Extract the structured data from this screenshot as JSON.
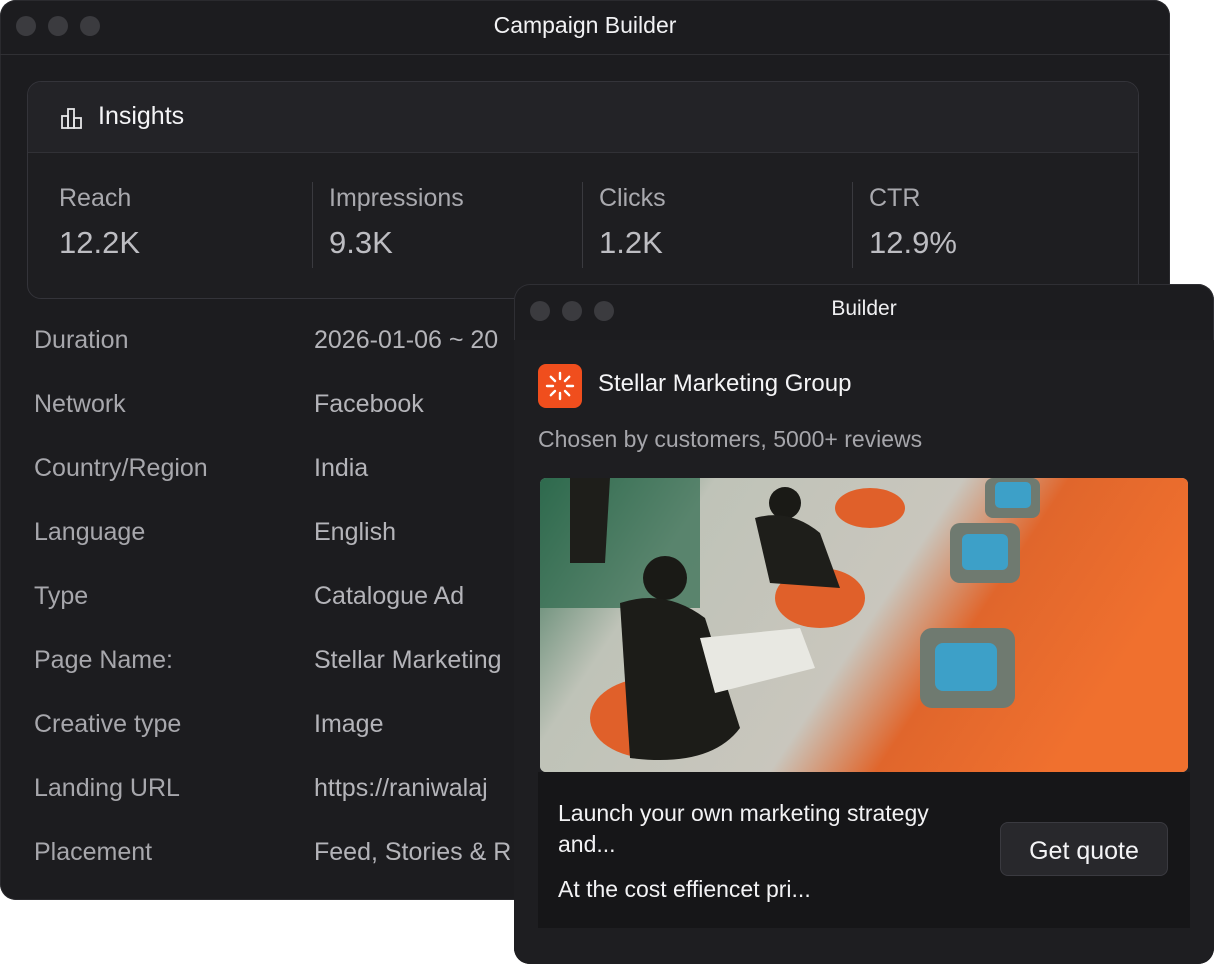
{
  "main_window": {
    "title": "Campaign Builder",
    "insights": {
      "title": "Insights",
      "icon": "bar-chart-icon",
      "metrics": [
        {
          "label": "Reach",
          "value": "12.2K"
        },
        {
          "label": "Impressions",
          "value": "9.3K"
        },
        {
          "label": "Clicks",
          "value": "1.2K"
        },
        {
          "label": "CTR",
          "value": "12.9%"
        }
      ]
    },
    "details": [
      {
        "label": "Duration",
        "value": "2026-01-06 ~ 20"
      },
      {
        "label": "Network",
        "value": "Facebook"
      },
      {
        "label": "Country/Region",
        "value": "India"
      },
      {
        "label": "Language",
        "value": "English"
      },
      {
        "label": "Type",
        "value": "Catalogue Ad"
      },
      {
        "label": "Page Name:",
        "value": "Stellar Marketing"
      },
      {
        "label": "Creative type",
        "value": "Image"
      },
      {
        "label": "Landing URL",
        "value": "https://raniwalaj"
      },
      {
        "label": "Placement",
        "value": "Feed, Stories & R"
      }
    ]
  },
  "builder_window": {
    "title": "Builder",
    "brand": {
      "name": "Stellar Marketing Group",
      "subtitle": "Chosen by customers, 5000+ reviews",
      "logo_color": "#f04e1d"
    },
    "ad": {
      "image_alt": "Vintage photo: men reading newspapers in orange chairs with TV monitors",
      "headline": "Launch your own marketing strategy and...",
      "description": "At the cost effiencet pri...",
      "cta_label": "Get quote"
    }
  },
  "colors": {
    "window_bg": "#1c1c1f",
    "accent": "#f04e1d"
  }
}
